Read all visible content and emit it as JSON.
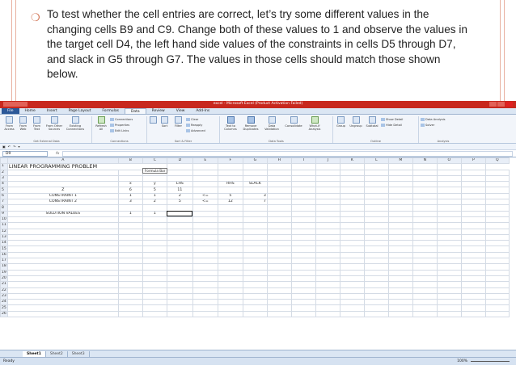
{
  "slide": {
    "bullet_text": "To test whether the cell entries are correct, let’s try some different values in the changing cells B9 and C9. Change both of these values to 1 and observe the values in the target cell D4, the left hand side values of the constraints in cells D5 through D7, and slack in G5 through G7. The values in those cells should match those shown below."
  },
  "excel": {
    "title": "excel - Microsoft Excel (Product Activation Failed)",
    "tabs": [
      "File",
      "Home",
      "Insert",
      "Page Layout",
      "Formulas",
      "Data",
      "Review",
      "View",
      "Add-Ins"
    ],
    "active_tab": "Data",
    "ribbon": {
      "from_access": "From Access",
      "from_web": "From Web",
      "from_text": "From Text",
      "from_other": "From Other Sources",
      "existing": "Existing Connections",
      "get_external_label": "Get External Data",
      "refresh_all": "Refresh All",
      "connections": "Connections",
      "properties": "Properties",
      "edit_links": "Edit Links",
      "connections_label": "Connections",
      "sort": "Sort",
      "filter": "Filter",
      "clear": "Clear",
      "reapply": "Reapply",
      "advanced": "Advanced",
      "sort_filter_label": "Sort & Filter",
      "text_to_columns": "Text to Columns",
      "remove_duplicates": "Remove Duplicates",
      "data_validation": "Data Validation",
      "consolidate": "Consolidate",
      "what_if": "What-If Analysis",
      "data_tools_label": "Data Tools",
      "group": "Group",
      "ungroup": "Ungroup",
      "subtotal": "Subtotal",
      "show_detail": "Show Detail",
      "hide_detail": "Hide Detail",
      "outline_label": "Outline",
      "data_analysis": "Data Analysis",
      "solver": "Solver",
      "analysis_label": "Analysis"
    },
    "name_box": "D9",
    "fx_label": "fx",
    "formula_tooltip": "Formula Bar",
    "columns": [
      "A",
      "B",
      "C",
      "D",
      "E",
      "F",
      "G",
      "H",
      "I",
      "J",
      "K",
      "L",
      "M",
      "N",
      "O",
      "P",
      "Q"
    ],
    "heading": "LINEAR PROGRAMMING PROBLEM",
    "header_row": {
      "b": "x",
      "c": "y",
      "d": "LHS",
      "f": "RHS",
      "g": "SLACK"
    },
    "rows": [
      {
        "a": "Z",
        "b": "6",
        "c": "5",
        "d": "11",
        "e": "",
        "f": "",
        "g": ""
      },
      {
        "a": "CONSTRAINT 1",
        "b": "1",
        "c": "1",
        "d": "2",
        "e": "<=",
        "f": "5",
        "g": "3"
      },
      {
        "a": "CONSTRAINT 2",
        "b": "3",
        "c": "2",
        "d": "5",
        "e": "<=",
        "f": "12",
        "g": "7"
      }
    ],
    "solution": {
      "a": "SOLUTION VALUES",
      "b": "1",
      "c": "1"
    },
    "sheet_tabs": [
      "Sheet1",
      "Sheet2",
      "Sheet3"
    ],
    "status": "Ready",
    "zoom": "100%"
  }
}
